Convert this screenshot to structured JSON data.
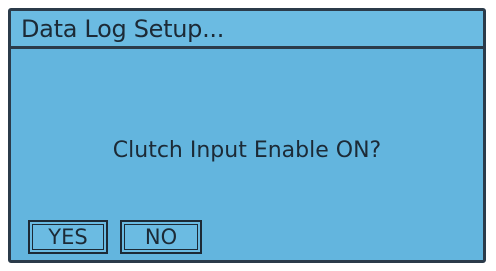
{
  "window": {
    "title": "Data Log Setup..."
  },
  "dialog": {
    "prompt": "Clutch Input Enable ON?"
  },
  "buttons": {
    "yes_label": "YES",
    "no_label": "NO"
  },
  "colors": {
    "screen_background": "#63b5de",
    "border": "#2b3b4a",
    "text": "#1c2a36"
  }
}
